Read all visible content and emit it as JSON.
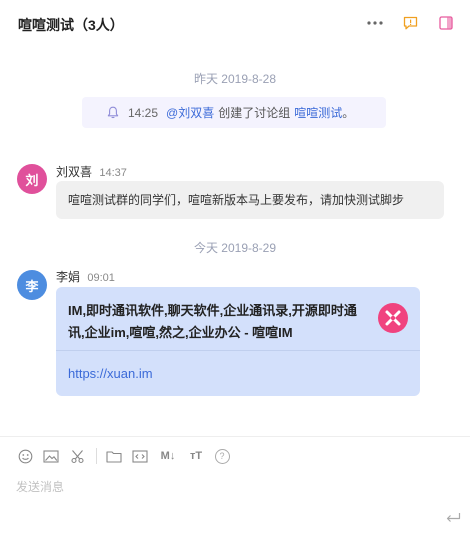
{
  "header": {
    "title": "喧喧测试（3人）",
    "icons": [
      "more-icon",
      "notice-icon",
      "sidebar-toggle-icon"
    ],
    "accent_color": "#f0a020",
    "sidebar_icon_color": "#e75b9e"
  },
  "messages": {
    "date_1": "昨天 2019-8-28",
    "system": {
      "time": "14:25",
      "mention": "@刘双喜",
      "action": "创建了讨论组",
      "group": "喧喧测试",
      "period": "。"
    },
    "msg_1": {
      "avatar": "刘",
      "avatar_color": "#e0509b",
      "sender": "刘双喜",
      "time": "14:37",
      "text": "喧喧测试群的同学们，喧喧新版本马上要发布，请加快测试脚步"
    },
    "date_2": "今天 2019-8-29",
    "msg_2": {
      "avatar": "李",
      "avatar_color": "#4d8de0",
      "sender": "李娟",
      "time": "09:01",
      "card": {
        "title": "IM,即时通讯软件,聊天软件,企业通讯录,开源即时通讯,企业im,喧喧,然之,企业办公 - 喧喧IM",
        "url": "https://xuan.im",
        "logo_color": "#f0437f"
      }
    }
  },
  "composer": {
    "placeholder": "发送消息",
    "tools": [
      "emoji-icon",
      "image-icon",
      "screenshot-icon",
      "folder-icon",
      "code-icon",
      "markdown-icon",
      "font-size-icon",
      "help-icon"
    ],
    "markdown_label": "M↓",
    "font_label": "ᴛT",
    "help_label": "?"
  }
}
